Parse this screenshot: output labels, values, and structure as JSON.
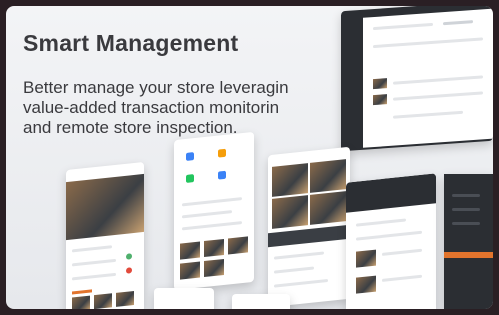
{
  "card": {
    "title": "Smart Management",
    "description_lines": [
      "Better manage your store leveragin",
      "value-added transaction monitorin",
      "and remote store inspection."
    ]
  },
  "colors": {
    "card_bg": "#f3f4f6",
    "text": "#3a3a3e",
    "accent": "#e2742d",
    "dark_panel": "#2b2e33",
    "page_bg": "#2a1f24"
  }
}
